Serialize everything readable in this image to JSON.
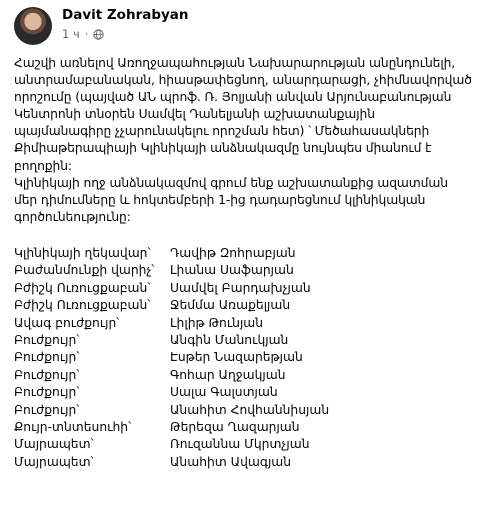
{
  "post": {
    "author": "Davit Zohrabyan",
    "time": "1 ч",
    "visibility_icon": "globe-icon",
    "paragraph": "Հաշվի առնելով Առողջապահության Նախարարության անընդունելի, անտրամաբանական, հիասթափեցնող, անարդարացի, չհիմնավորված որոշումը (պայված ԱՆ պրոֆ. Ռ. Յոլյանի անվան Արյունաբանության Կենտրոնի տնօրեն Սամվել Դանելյանի աշխատանքային պայմանագիրը չչարունակելու որոշման հետ) ՝ Մեծահասակների Քիմիաթերապիայի Կլինիկայի անձնակազմը նույնպես միանում է բողոքին:",
    "paragraph2": "Կլինիկայի ողջ անձնակազմով գրում ենք աշխատանքից ազատման մեր դիմումները և հոկտեմբերի 1-ից դադարեցնում կլինիկական գործունեությունը:",
    "staff": [
      {
        "role": "Կլինիկայի ղեկավար՝",
        "name": "Դավիթ Զոհրաբյան"
      },
      {
        "role": "Բաժանմունքի վարիչ՝",
        "name": "Լիանա Սաֆարյան"
      },
      {
        "role": "Բժիշկ Ուռուցքաբան՝",
        "name": "Սամվել Բարդախչյան"
      },
      {
        "role": "Բժիշկ Ուռուցքաբան՝",
        "name": "Ջեմմա Առաքելյան"
      },
      {
        "role": "Ավագ բուժքույր՝",
        "name": "Լիլիթ Թունյան"
      },
      {
        "role": "Բուժքույր՝",
        "name": "Անգին Մանուկյան"
      },
      {
        "role": "Բուժքույր՝",
        "name": "Էսթեր Նազարեթյան"
      },
      {
        "role": "Բուժքույր՝",
        "name": "Գոհար Աղջակյան"
      },
      {
        "role": "Բուժքույր՝",
        "name": "Սալա Գալստյան"
      },
      {
        "role": "Բուժքույր՝",
        "name": "Անահիտ Հովհաննիսյան"
      },
      {
        "role": "Քույր-տնտեսուհի՝",
        "name": "Թերեզա Ղազարյան"
      },
      {
        "role": "Մայրապետ՝",
        "name": "Ռուզաննա Մկրտչյան"
      },
      {
        "role": "Մայրապետ՝",
        "name": "Անահիտ Ավագյան"
      }
    ]
  }
}
